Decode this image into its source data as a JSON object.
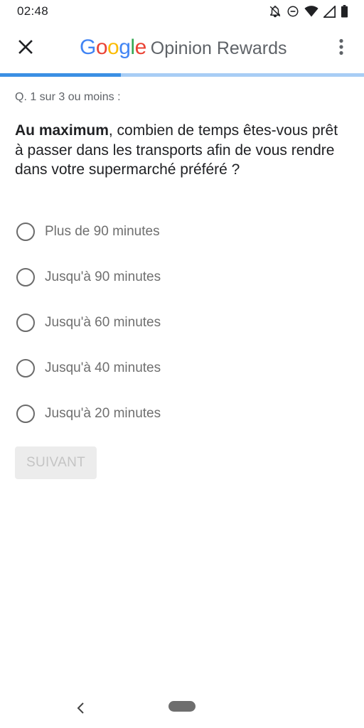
{
  "status_bar": {
    "time": "02:48",
    "icons": [
      "notifications-off-icon",
      "do-not-disturb-icon",
      "wifi-icon",
      "signal-icon",
      "battery-icon"
    ]
  },
  "app_bar": {
    "brand_google_letters": [
      "G",
      "o",
      "o",
      "g",
      "l",
      "e"
    ],
    "brand_product": "Opinion Rewards",
    "close_icon": "close-icon",
    "menu_icon": "more-vert-icon"
  },
  "progress": {
    "fraction": 0.333
  },
  "question": {
    "counter": "Q. 1 sur 3 ou moins :",
    "text_bold": "Au maximum",
    "text_rest": ", combien de temps êtes-vous prêt à passer dans les transports afin de vous rendre dans votre supermarché préféré ?"
  },
  "options": [
    {
      "label": "Plus de 90 minutes"
    },
    {
      "label": "Jusqu'à 90 minutes"
    },
    {
      "label": "Jusqu'à 60 minutes"
    },
    {
      "label": "Jusqu'à 40 minutes"
    },
    {
      "label": "Jusqu'à 20 minutes"
    }
  ],
  "next_button": {
    "label": "SUIVANT",
    "enabled": false
  },
  "colors": {
    "progress_fill": "#3b8fe4",
    "progress_track": "#a8cdf5",
    "google_blue": "#4285F4",
    "google_red": "#EA4335",
    "google_yellow": "#FBBC05",
    "google_green": "#34A853"
  }
}
